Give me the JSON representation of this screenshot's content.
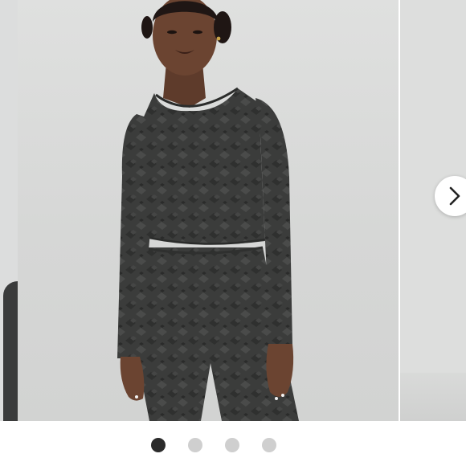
{
  "gallery": {
    "slide_count": 4,
    "active_index": 0,
    "dots": [
      {
        "state": "active"
      },
      {
        "state": "inactive"
      },
      {
        "state": "inactive"
      },
      {
        "state": "inactive"
      }
    ],
    "next_button_icon": "chevron-right-icon"
  },
  "colors": {
    "background": "#dfe0df",
    "dot_active": "#2b2b2b",
    "dot_inactive": "#cfcfcf",
    "garment": "#3a3b3b",
    "skin": "#6b4431"
  }
}
